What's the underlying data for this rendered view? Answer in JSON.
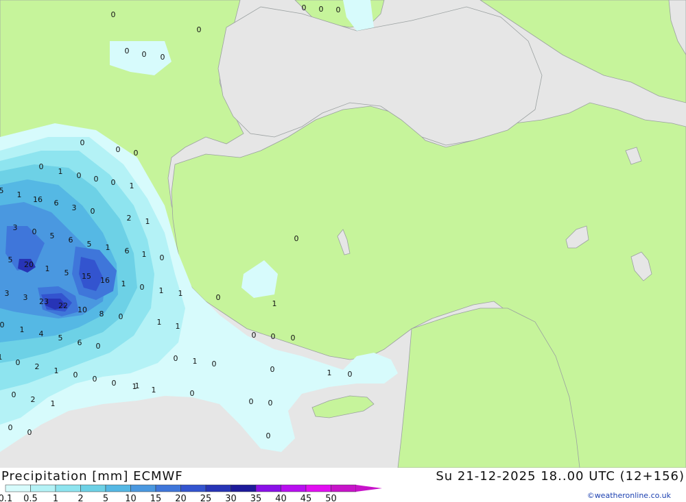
{
  "header": {
    "title": "Precipitation [mm] ECMWF",
    "datetime": "Su 21-12-2025 18..00 UTC (12+156)",
    "credit": "©weatheronline.co.uk"
  },
  "colors": {
    "land": "#c6f49b",
    "sea": "#e6e6e6",
    "border": "#9aa0a0"
  },
  "legend": {
    "labels": [
      "0.1",
      "0.5",
      "1",
      "2",
      "5",
      "10",
      "15",
      "20",
      "25",
      "30",
      "35",
      "40",
      "45",
      "50"
    ],
    "colors": [
      "#d7fbfc",
      "#b4f2f6",
      "#8ee4ef",
      "#6dd1e6",
      "#55b8e4",
      "#4a98e0",
      "#3f76da",
      "#3354cf",
      "#2734b6",
      "#1d1a9a",
      "#8a10e8",
      "#b80ef0",
      "#e20ef2",
      "#c713c9"
    ]
  },
  "map_values": [
    "0",
    "0",
    "0",
    "0",
    "0",
    "0",
    "0",
    "0",
    "0",
    "0",
    "0",
    "0",
    "1",
    "0",
    "0",
    "0",
    "1",
    "5",
    "1",
    "16",
    "6",
    "3",
    "0",
    "3",
    "0",
    "5",
    "6",
    "5",
    "1",
    "6",
    "2",
    "1",
    "5",
    "20",
    "1",
    "5",
    "15",
    "16",
    "1",
    "1",
    "3",
    "3",
    "23",
    "22",
    "10",
    "8",
    "0",
    "0",
    "1",
    "1",
    "0",
    "1",
    "4",
    "5",
    "6",
    "0",
    "0",
    "1",
    "1",
    "0",
    "2",
    "1",
    "0",
    "0",
    "0",
    "1",
    "1",
    "0",
    "1",
    "0",
    "2",
    "1",
    "0",
    "0",
    "0",
    "0",
    "0",
    "0",
    "0",
    "0",
    "1",
    "0",
    "0",
    "0",
    "0"
  ]
}
